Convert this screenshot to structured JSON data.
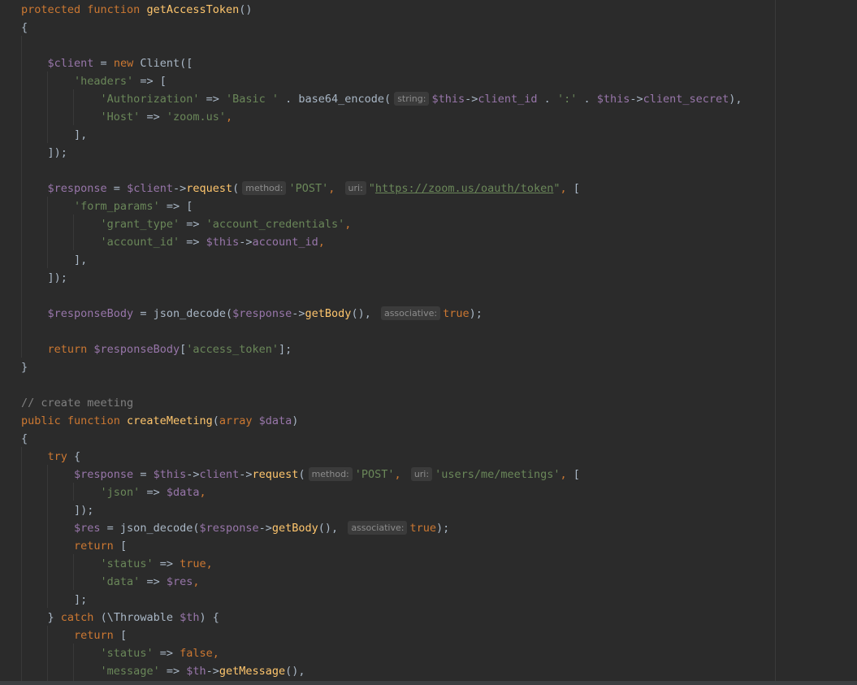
{
  "editor": {
    "theme": "darcula",
    "colors": {
      "background": "#2b2b2b",
      "keyword": "#cc7832",
      "function": "#ffc66d",
      "variable": "#9876aa",
      "string": "#6a8759",
      "comment": "#808080",
      "default": "#a9b7c6"
    },
    "lines": [
      [
        {
          "t": "protected function ",
          "c": "kw"
        },
        {
          "t": "getAccessToken",
          "c": "fn"
        },
        {
          "t": "()"
        }
      ],
      [
        {
          "t": "{"
        }
      ],
      [],
      [
        {
          "t": "    "
        },
        {
          "t": "$client",
          "c": "var"
        },
        {
          "t": " = "
        },
        {
          "t": "new ",
          "c": "kw"
        },
        {
          "t": "Client(["
        }
      ],
      [
        {
          "t": "        "
        },
        {
          "t": "'headers'",
          "c": "str"
        },
        {
          "t": " => ["
        }
      ],
      [
        {
          "t": "            "
        },
        {
          "t": "'Authorization'",
          "c": "str"
        },
        {
          "t": " => "
        },
        {
          "t": "'Basic '",
          "c": "str"
        },
        {
          "t": " . base64_encode("
        },
        {
          "h": "string:"
        },
        {
          "t": "$this",
          "c": "var"
        },
        {
          "t": "->"
        },
        {
          "t": "client_id",
          "c": "var"
        },
        {
          "t": " . "
        },
        {
          "t": "':'",
          "c": "str"
        },
        {
          "t": " . "
        },
        {
          "t": "$this",
          "c": "var"
        },
        {
          "t": "->"
        },
        {
          "t": "client_secret",
          "c": "var"
        },
        {
          "t": "),"
        }
      ],
      [
        {
          "t": "            "
        },
        {
          "t": "'Host'",
          "c": "str"
        },
        {
          "t": " => "
        },
        {
          "t": "'zoom.us'",
          "c": "str"
        },
        {
          "t": ",",
          "c": "kw"
        }
      ],
      [
        {
          "t": "        ],"
        }
      ],
      [
        {
          "t": "    ]);"
        }
      ],
      [],
      [
        {
          "t": "    "
        },
        {
          "t": "$response",
          "c": "var"
        },
        {
          "t": " = "
        },
        {
          "t": "$client",
          "c": "var"
        },
        {
          "t": "->"
        },
        {
          "t": "request",
          "c": "fn"
        },
        {
          "t": "("
        },
        {
          "h": "method:"
        },
        {
          "t": "'POST'",
          "c": "str"
        },
        {
          "t": ", ",
          "c": "kw"
        },
        {
          "h": "uri:"
        },
        {
          "t": "\"",
          "c": "str"
        },
        {
          "t": "https://zoom.us/oauth/token",
          "c": "url"
        },
        {
          "t": "\"",
          "c": "str"
        },
        {
          "t": ", ",
          "c": "kw"
        },
        {
          "t": "["
        }
      ],
      [
        {
          "t": "        "
        },
        {
          "t": "'form_params'",
          "c": "str"
        },
        {
          "t": " => ["
        }
      ],
      [
        {
          "t": "            "
        },
        {
          "t": "'grant_type'",
          "c": "str"
        },
        {
          "t": " => "
        },
        {
          "t": "'account_credentials'",
          "c": "str"
        },
        {
          "t": ",",
          "c": "kw"
        }
      ],
      [
        {
          "t": "            "
        },
        {
          "t": "'account_id'",
          "c": "str"
        },
        {
          "t": " => "
        },
        {
          "t": "$this",
          "c": "var"
        },
        {
          "t": "->"
        },
        {
          "t": "account_id",
          "c": "var"
        },
        {
          "t": ",",
          "c": "kw"
        }
      ],
      [
        {
          "t": "        ],"
        }
      ],
      [
        {
          "t": "    ]);"
        }
      ],
      [],
      [
        {
          "t": "    "
        },
        {
          "t": "$responseBody",
          "c": "var"
        },
        {
          "t": " = json_decode("
        },
        {
          "t": "$response",
          "c": "var"
        },
        {
          "t": "->"
        },
        {
          "t": "getBody",
          "c": "fn"
        },
        {
          "t": "(), "
        },
        {
          "h": "associative:"
        },
        {
          "t": "true",
          "c": "kw"
        },
        {
          "t": ");"
        }
      ],
      [],
      [
        {
          "t": "    "
        },
        {
          "t": "return ",
          "c": "kw"
        },
        {
          "t": "$responseBody",
          "c": "var"
        },
        {
          "t": "["
        },
        {
          "t": "'access_token'",
          "c": "str"
        },
        {
          "t": "];"
        }
      ],
      [
        {
          "t": "}"
        }
      ],
      [],
      [
        {
          "t": "// create meeting",
          "c": "cmt"
        }
      ],
      [
        {
          "t": "public function ",
          "c": "kw"
        },
        {
          "t": "createMeeting",
          "c": "fn"
        },
        {
          "t": "("
        },
        {
          "t": "array ",
          "c": "kw"
        },
        {
          "t": "$data",
          "c": "var"
        },
        {
          "t": ")"
        }
      ],
      [
        {
          "t": "{"
        }
      ],
      [
        {
          "t": "    "
        },
        {
          "t": "try ",
          "c": "kw"
        },
        {
          "t": "{"
        }
      ],
      [
        {
          "t": "        "
        },
        {
          "t": "$response",
          "c": "var"
        },
        {
          "t": " = "
        },
        {
          "t": "$this",
          "c": "var"
        },
        {
          "t": "->"
        },
        {
          "t": "client",
          "c": "var"
        },
        {
          "t": "->"
        },
        {
          "t": "request",
          "c": "fn"
        },
        {
          "t": "("
        },
        {
          "h": "method:"
        },
        {
          "t": "'POST'",
          "c": "str"
        },
        {
          "t": ", ",
          "c": "kw"
        },
        {
          "h": "uri:"
        },
        {
          "t": "'users/me/meetings'",
          "c": "str"
        },
        {
          "t": ", ",
          "c": "kw"
        },
        {
          "t": "["
        }
      ],
      [
        {
          "t": "            "
        },
        {
          "t": "'json'",
          "c": "str"
        },
        {
          "t": " => "
        },
        {
          "t": "$data",
          "c": "var"
        },
        {
          "t": ",",
          "c": "kw"
        }
      ],
      [
        {
          "t": "        ]);"
        }
      ],
      [
        {
          "t": "        "
        },
        {
          "t": "$res",
          "c": "var"
        },
        {
          "t": " = json_decode("
        },
        {
          "t": "$response",
          "c": "var"
        },
        {
          "t": "->"
        },
        {
          "t": "getBody",
          "c": "fn"
        },
        {
          "t": "(), "
        },
        {
          "h": "associative:"
        },
        {
          "t": "true",
          "c": "kw"
        },
        {
          "t": ");"
        }
      ],
      [
        {
          "t": "        "
        },
        {
          "t": "return ",
          "c": "kw"
        },
        {
          "t": "["
        }
      ],
      [
        {
          "t": "            "
        },
        {
          "t": "'status'",
          "c": "str"
        },
        {
          "t": " => "
        },
        {
          "t": "true",
          "c": "kw"
        },
        {
          "t": ",",
          "c": "kw"
        }
      ],
      [
        {
          "t": "            "
        },
        {
          "t": "'data'",
          "c": "str"
        },
        {
          "t": " => "
        },
        {
          "t": "$res",
          "c": "var"
        },
        {
          "t": ",",
          "c": "kw"
        }
      ],
      [
        {
          "t": "        ];"
        }
      ],
      [
        {
          "t": "    } "
        },
        {
          "t": "catch ",
          "c": "kw"
        },
        {
          "t": "(\\Throwable "
        },
        {
          "t": "$th",
          "c": "var"
        },
        {
          "t": ") {"
        }
      ],
      [
        {
          "t": "        "
        },
        {
          "t": "return ",
          "c": "kw"
        },
        {
          "t": "["
        }
      ],
      [
        {
          "t": "            "
        },
        {
          "t": "'status'",
          "c": "str"
        },
        {
          "t": " => "
        },
        {
          "t": "false",
          "c": "kw"
        },
        {
          "t": ",",
          "c": "kw"
        }
      ],
      [
        {
          "t": "            "
        },
        {
          "t": "'message'",
          "c": "str"
        },
        {
          "t": " => "
        },
        {
          "t": "$th",
          "c": "var"
        },
        {
          "t": "->"
        },
        {
          "t": "getMessage",
          "c": "fn"
        },
        {
          "t": "(),"
        }
      ]
    ]
  }
}
